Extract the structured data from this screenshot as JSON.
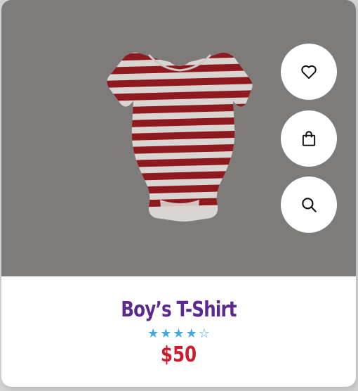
{
  "product": {
    "name": "Boy’s T-Shirt",
    "price": "$50",
    "rating": {
      "value": 4,
      "max": 5
    },
    "star_filled": "★",
    "star_empty": "☆",
    "image_icon": "striped-onesie-image"
  },
  "actions": [
    {
      "name": "wishlist",
      "icon": "heart-icon"
    },
    {
      "name": "add-to-cart",
      "icon": "shopping-bag-icon"
    },
    {
      "name": "quick-view",
      "icon": "search-icon"
    }
  ],
  "colors": {
    "title": "#5a2a91",
    "price": "#cc1d2e",
    "stars": "#3fa9e0",
    "image_overlay": "#7d7c7b",
    "stripe_red": "#8e1a1f",
    "stripe_white": "#d9d5d2"
  }
}
